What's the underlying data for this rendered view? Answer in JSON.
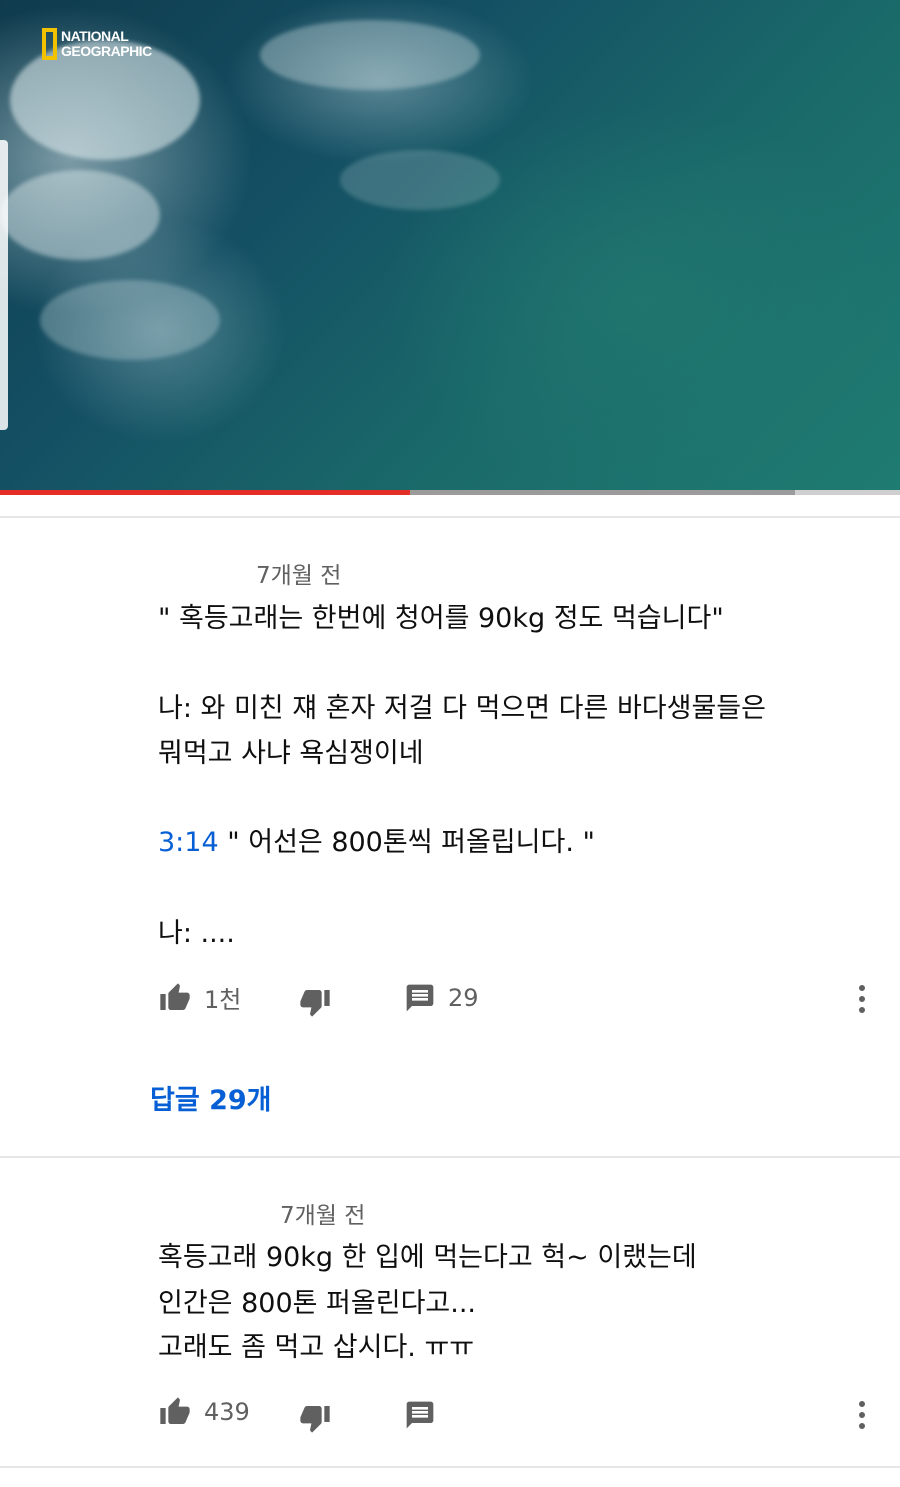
{
  "video": {
    "logo_text_line1": "NATIONAL",
    "logo_text_line2": "GEOGRAPHIC",
    "progress_played_fraction": 0.455,
    "progress_buffered_fraction": 0.883,
    "accent_color": "#e52d27"
  },
  "comments": [
    {
      "time": "7개월 전",
      "lines": [
        "\" 혹등고래는 한번에 청어를 90kg 정도 먹습니다\"",
        "나: 와 미친 쟤 혼자 저걸 다 먹으면 다른 바다생물들은",
        "뭐먹고 사냐 욕심쟁이네"
      ],
      "timestamp_link": "3:14",
      "timestamp_rest": " \" 어선은 800톤씩 퍼올립니다. \"",
      "last_line": "나: ....",
      "likes": "1천",
      "replies_count": "29",
      "view_replies": "답글 29개",
      "icons": [
        "thumb-up-icon",
        "thumb-down-icon",
        "reply-icon",
        "more-vert-icon"
      ]
    },
    {
      "time": "7개월 전",
      "lines": [
        "혹등고래 90kg 한 입에 먹는다고 헉~ 이랬는데",
        "인간은 800톤 퍼올린다고...",
        "고래도 좀 먹고 삽시다. ㅠㅠ"
      ],
      "likes": "439",
      "icons": [
        "thumb-up-icon",
        "thumb-down-icon",
        "reply-icon",
        "more-vert-icon"
      ]
    }
  ]
}
